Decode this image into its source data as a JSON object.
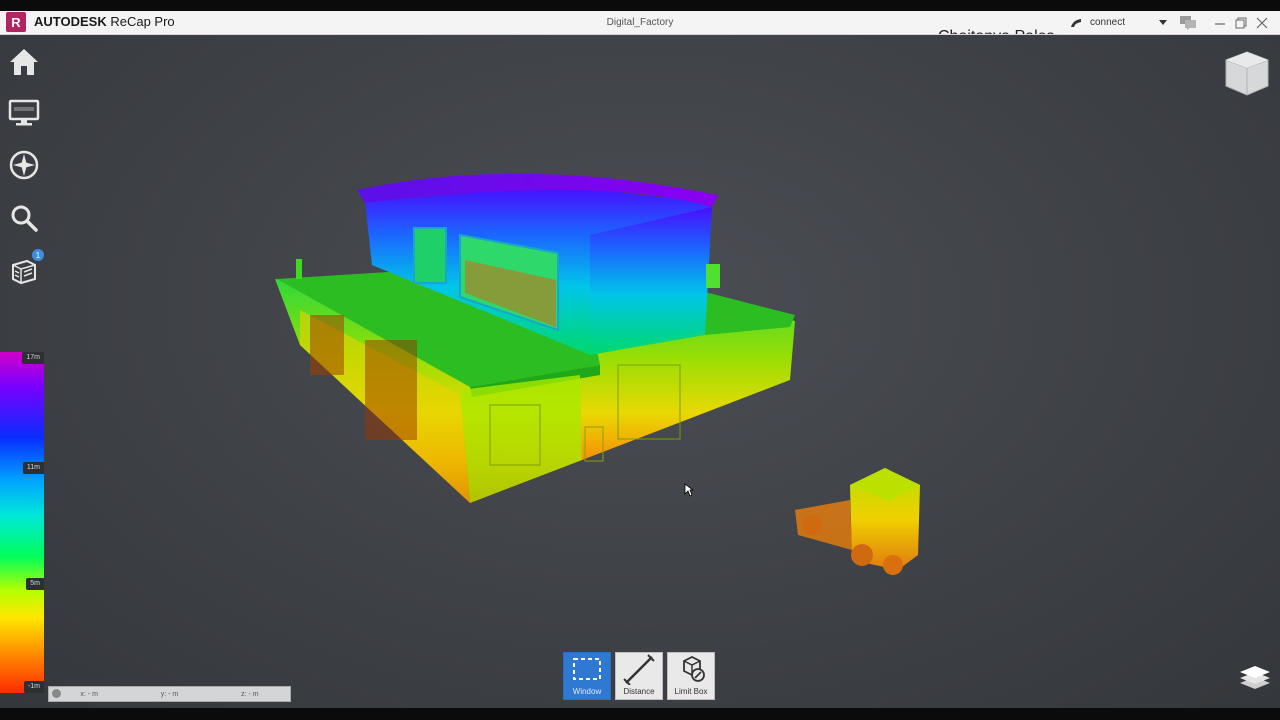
{
  "titlebar": {
    "logo_letter": "R",
    "app_name_bold": "AUTODESK",
    "app_name_rest": " ReCap Pro",
    "document": "Digital_Factory",
    "overlap_text": "Chaitanya Pales",
    "connect_label": "connect"
  },
  "left_toolbar": {
    "items": [
      {
        "name": "home-icon"
      },
      {
        "name": "monitor-icon"
      },
      {
        "name": "navigation-compass-icon"
      },
      {
        "name": "search-icon"
      },
      {
        "name": "scan-region-icon",
        "badge": "1"
      }
    ]
  },
  "color_scale": {
    "ticks": [
      {
        "label": "17m",
        "value": 17
      },
      {
        "label": "11m",
        "value": 11
      },
      {
        "label": "5m",
        "value": 5
      },
      {
        "label": "-1m",
        "value": -1
      }
    ]
  },
  "coordinates": {
    "x": "x: - m",
    "y": "y: - m",
    "z": "z: - m"
  },
  "bottom_tools": [
    {
      "label": "Window",
      "icon": "window-select-icon",
      "active": true
    },
    {
      "label": "Distance",
      "icon": "distance-measure-icon",
      "active": false
    },
    {
      "label": "Limit Box",
      "icon": "limit-box-icon",
      "active": false
    }
  ],
  "colors": {
    "accent": "#2f79d2",
    "logo": "#b32561",
    "viewport": "#3f4247"
  }
}
